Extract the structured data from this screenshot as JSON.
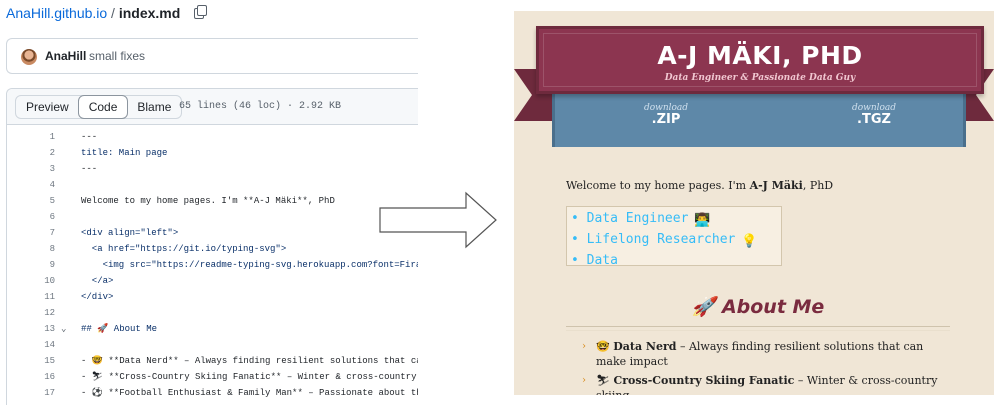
{
  "github": {
    "breadcrumb": {
      "repo": "AnaHill.github.io",
      "separator": " / ",
      "file": "index.md"
    },
    "commit": {
      "author": "AnaHill",
      "message": "small fixes"
    },
    "tabs": [
      "Preview",
      "Code",
      "Blame"
    ],
    "active_tab": "Code",
    "file_stats": "65 lines (46 loc) · 2.92 KB",
    "lines": [
      {
        "n": "1",
        "text": "---"
      },
      {
        "n": "2",
        "text": "title: Main page"
      },
      {
        "n": "3",
        "text": "---"
      },
      {
        "n": "4",
        "text": ""
      },
      {
        "n": "5",
        "text": "Welcome to my home pages. I'm **A-J Mäki**, PhD"
      },
      {
        "n": "6",
        "text": ""
      },
      {
        "n": "7",
        "text": "<div align=\"left\">"
      },
      {
        "n": "8",
        "text": "  <a href=\"https://git.io/typing-svg\">"
      },
      {
        "n": "9",
        "text": "    <img src=\"https://readme-typing-svg.herokuapp.com?font=Fira"
      },
      {
        "n": "10",
        "text": "  </a>"
      },
      {
        "n": "11",
        "text": "</div>"
      },
      {
        "n": "12",
        "text": ""
      },
      {
        "n": "13",
        "text": "## 🚀 About Me"
      },
      {
        "n": "14",
        "text": ""
      },
      {
        "n": "15",
        "text": "- 🤓 **Data Nerd** – Always finding resilient solutions that ca"
      },
      {
        "n": "16",
        "text": "- ⛷ **Cross-Country Skiing Fanatic** – Winter & cross-country"
      },
      {
        "n": "17",
        "text": "- ⚽ **Football Enthusiast & Family Man** – Passionate about th"
      }
    ]
  },
  "site": {
    "title": "A-J MÄKI, PHD",
    "subtitle": "Data Engineer & Passionate Data Guy",
    "downloads": [
      {
        "small": "download",
        "big": ".ZIP"
      },
      {
        "small": "download",
        "big": ".TGZ"
      }
    ],
    "welcome_pre": "Welcome to my home pages. I'm ",
    "welcome_name": "A-J Mäki",
    "welcome_post": ", PhD",
    "typing_lines": [
      {
        "text": "• Data Engineer",
        "emoji": "👨‍💻"
      },
      {
        "text": "• Lifelong Researcher",
        "emoji": "💡"
      },
      {
        "text": "• Data",
        "emoji": ""
      }
    ],
    "about_heading": "🚀 About Me",
    "about_items": [
      {
        "emoji": "🤓",
        "bold": "Data Nerd",
        "rest": " – Always finding resilient solutions that can make impact"
      },
      {
        "emoji": "⛷",
        "bold": "Cross-Country Skiing Fanatic",
        "rest": " – Winter & cross-country skiing"
      }
    ]
  }
}
